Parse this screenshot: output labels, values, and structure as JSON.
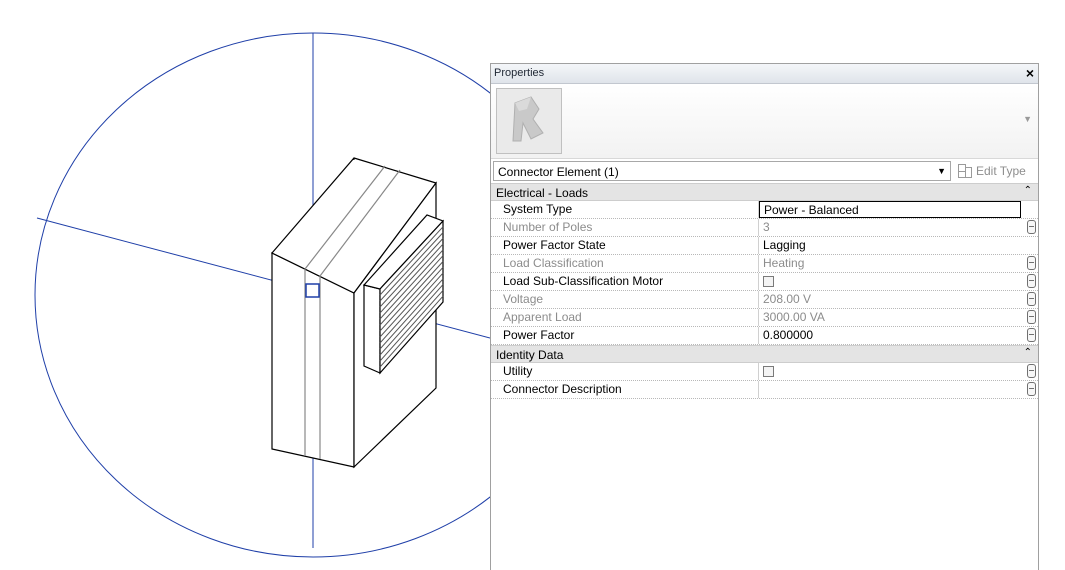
{
  "properties_panel": {
    "title": "Properties",
    "close_glyph": "×",
    "type_thumbnail_icon": "revit-family-icon",
    "element_selector": "Connector Element (1)",
    "edit_type_label": "Edit Type",
    "groups": [
      {
        "label": "Electrical - Loads",
        "collapse_glyph": "⌃",
        "rows": [
          {
            "name": "System Type",
            "value": "Power - Balanced",
            "enabled": true,
            "editing": true,
            "param_button": false
          },
          {
            "name": "Number of Poles",
            "value": "3",
            "enabled": false,
            "param_button": true
          },
          {
            "name": "Power Factor State",
            "value": "Lagging",
            "enabled": true,
            "param_button": false
          },
          {
            "name": "Load Classification",
            "value": "Heating",
            "enabled": false,
            "param_button": true
          },
          {
            "name": "Load Sub-Classification Motor",
            "value": "",
            "checkbox": true,
            "checked": false,
            "enabled": true,
            "param_button": true
          },
          {
            "name": "Voltage",
            "value": "208.00 V",
            "enabled": false,
            "param_button": true
          },
          {
            "name": "Apparent Load",
            "value": "3000.00 VA",
            "enabled": false,
            "param_button": true
          },
          {
            "name": "Power Factor",
            "value": "0.800000",
            "enabled": true,
            "param_button": true
          }
        ]
      },
      {
        "label": "Identity Data",
        "collapse_glyph": "⌃",
        "rows": [
          {
            "name": "Utility",
            "value": "",
            "checkbox": true,
            "checked": false,
            "enabled": true,
            "param_button": true
          },
          {
            "name": "Connector Description",
            "value": "",
            "enabled": true,
            "param_button": true
          }
        ]
      }
    ]
  },
  "colors": {
    "work_plane": "#1f3fa8",
    "model_lines": "#000000",
    "hatch": "#555555"
  }
}
